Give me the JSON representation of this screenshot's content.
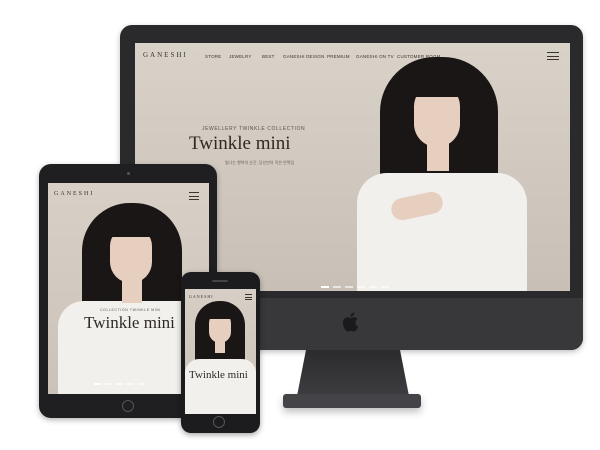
{
  "desktop": {
    "logo": "GANESHI",
    "nav": [
      "STORE",
      "JEWELRY",
      "BEST",
      "GANESHI DESIGN",
      "PREMIUM",
      "GANESHI ON TV",
      "CUSTOMER ROOM"
    ],
    "hero_subtitle": "JEWELLERY TWINKLE COLLECTION",
    "hero_title": "Twinkle mini",
    "hero_description": "빛나는 행복의 순간, 당신만의 작은 반짝임",
    "slide_count": 6,
    "active_slide": 1
  },
  "tablet": {
    "logo": "GANESHI",
    "hero_subtitle": "COLLECTION TWINKLE MINI",
    "hero_title": "Twinkle mini",
    "slide_count": 5,
    "active_slide": 1
  },
  "mobile": {
    "logo": "GANESHI",
    "hero_title": "Twinkle mini",
    "slide_count": 4,
    "active_slide": 1
  },
  "colors": {
    "background": "#ffffff",
    "device_frame": "#2a2a2c",
    "screen_bg": "#d3cbc2",
    "text_dark": "#2f2a26"
  }
}
